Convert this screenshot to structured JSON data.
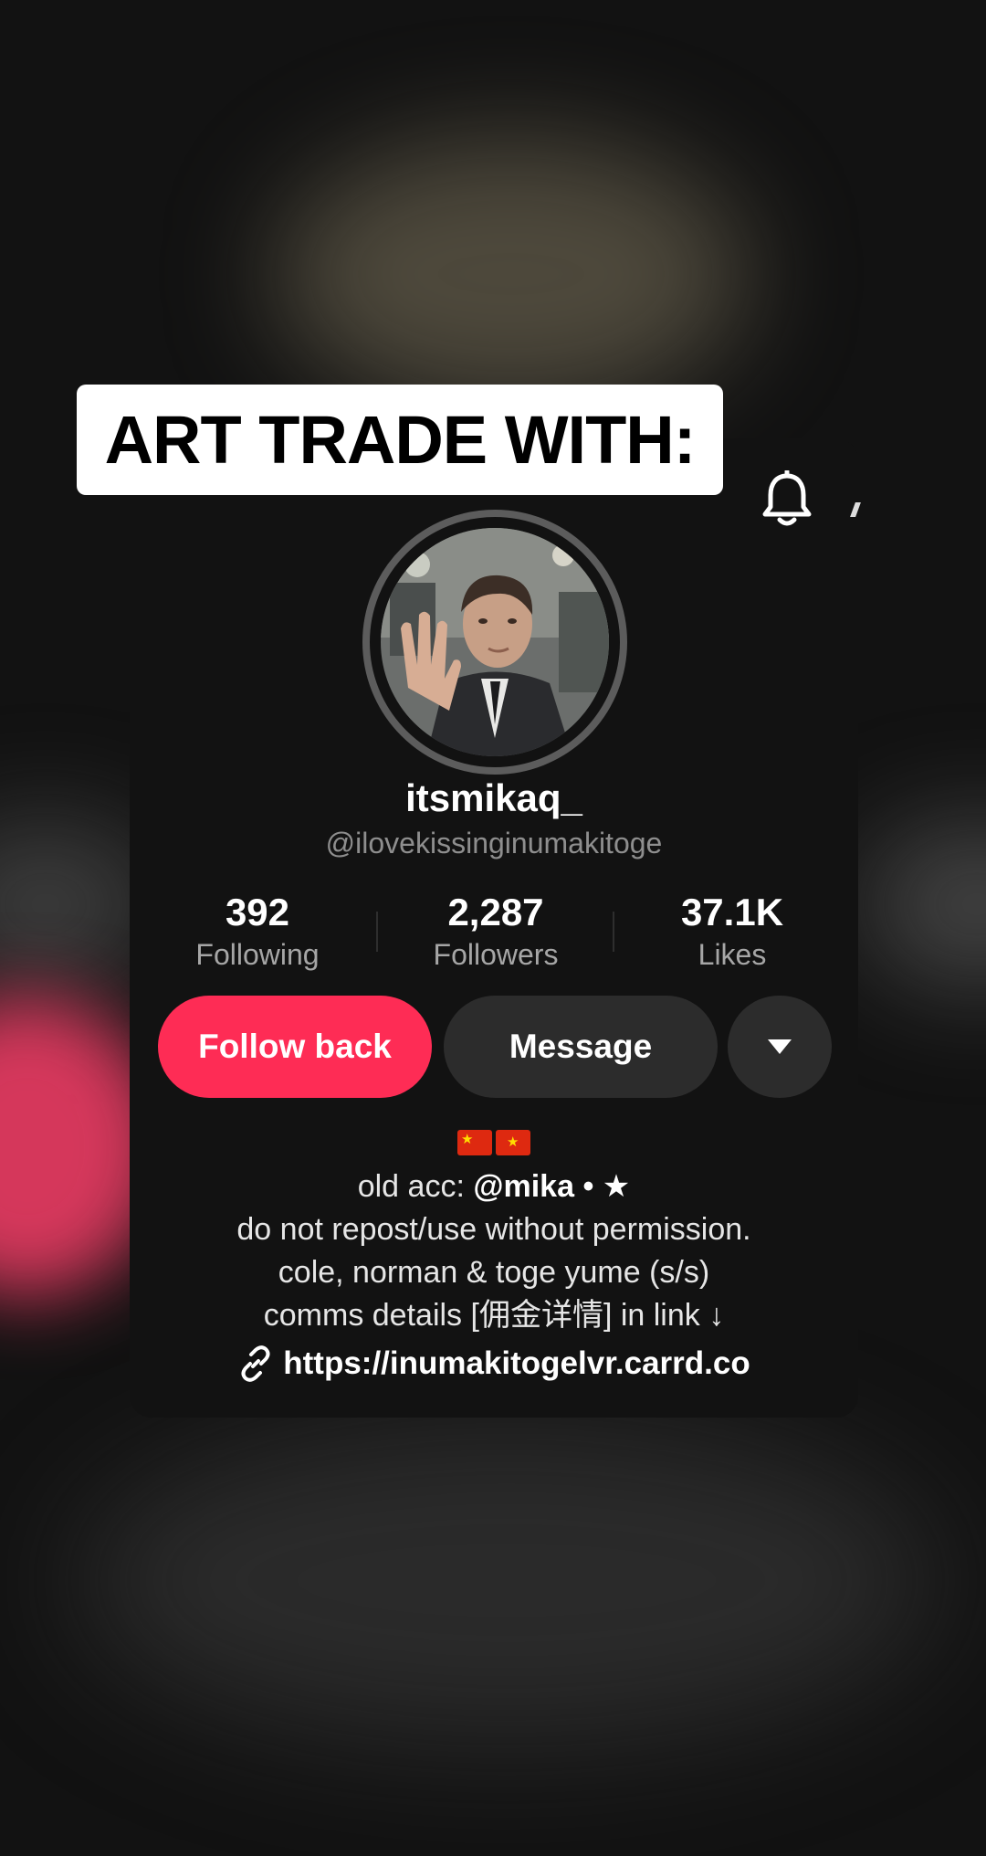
{
  "overlay": {
    "title": "ART TRADE WITH:"
  },
  "profile": {
    "username": "itsmikaq_",
    "handle": "@ilovekissinginumakitoge",
    "stats": [
      {
        "value": "392",
        "label": "Following"
      },
      {
        "value": "2,287",
        "label": "Followers"
      },
      {
        "value": "37.1K",
        "label": "Likes"
      }
    ]
  },
  "actions": {
    "follow_back": "Follow back",
    "message": "Message"
  },
  "bio": {
    "line1_prefix": "old acc: ",
    "line1_handle": "@mika",
    "line1_suffix": " • ★",
    "line2": "do not repost/use without permission.",
    "line3": "cole, norman & toge yume (s/s)",
    "line4": "comms details [佣金详情] in link ↓",
    "link": "https://inumakitogelvr.carrd.co"
  },
  "icons": {
    "bell": "bell-icon",
    "dropdown": "triangle-down-icon",
    "link": "link-icon",
    "flags": [
      "china-flag-icon",
      "vietnam-flag-icon"
    ]
  },
  "colors": {
    "primary": "#fe2c55",
    "background": "#121212",
    "secondary_button": "#2c2c2c"
  }
}
